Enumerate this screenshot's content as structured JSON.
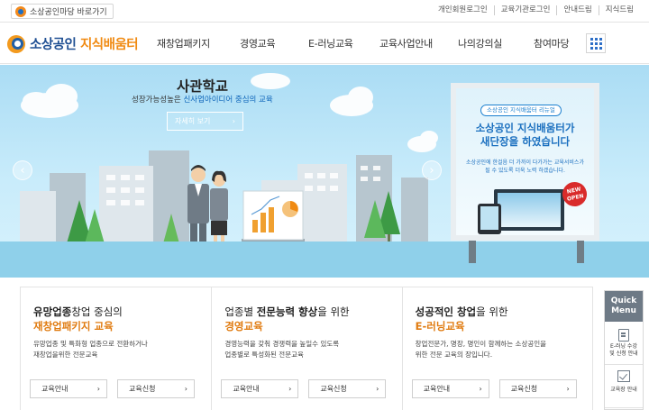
{
  "topbar": {
    "mall_link": "소상공인마당 바로가기",
    "util_links": [
      "개인회원로그인",
      "교육기관로그인",
      "안내드림",
      "지식드림"
    ]
  },
  "header": {
    "logo_part1": "소상공인",
    "logo_part2": "지식배움터",
    "nav": [
      "재창업패키지",
      "경영교육",
      "E-러닝교육",
      "교육사업안내",
      "나의강의실",
      "참여마당"
    ],
    "grid_menu_icon": "grid-icon"
  },
  "hero": {
    "title": "사관학교",
    "subtitle_prefix": "성장가능성높은 ",
    "subtitle_highlight": "신사업아이디어 중심의 교육",
    "detail_button": "자세히 보기",
    "panel": {
      "tag": "소상공인 지식배움터 리뉴얼",
      "headline_line1": "소상공인 지식배움터가",
      "headline_line2": "새단장을 하였습니다",
      "desc_line1": "소상공인에 한걸음 더 가까이 다가가는 교육서비스가",
      "desc_line2": "될 수 있도록 더욱 노력 하겠습니다.",
      "badge_line1": "NEW",
      "badge_line2": "OPEN"
    }
  },
  "cards": [
    {
      "title1_a": "유망업종",
      "title1_b": "창업 중심의",
      "title2": "재창업패키지 교육",
      "desc_line1": "유망업종 및 특화형 업종으로 전환하거나",
      "desc_line2": "재창업을위한 전문교육",
      "btn_info": "교육안내",
      "btn_apply": "교육신청"
    },
    {
      "title1_a": "업종별 ",
      "title1_b": "전문능력 향상",
      "title1_c": "을 위한",
      "title2": "경영교육",
      "desc_line1": "경영능력을 갖춰 경쟁력을 높일수 있도록",
      "desc_line2": "업종별로 특성화된 전문교육",
      "btn_info": "교육안내",
      "btn_apply": "교육신청"
    },
    {
      "title1_a": "성공적인 창업",
      "title1_b": "을 위한",
      "title2": "E-러닝교육",
      "desc_line1": "창업전문가, 명장, 명인이 함께하는 소상공인을",
      "desc_line2": "위한 전문 교육의 장입니다.",
      "btn_info": "교육안내",
      "btn_apply": "교육신청"
    }
  ],
  "quick_menu": {
    "title_line1": "Quick",
    "title_line2": "Menu",
    "items": [
      {
        "line1": "E-러닝 수강",
        "line2": "및 신청 안내",
        "icon": "document-icon"
      },
      {
        "line1": "교육장 안내",
        "icon": "checkbox-icon"
      }
    ]
  }
}
